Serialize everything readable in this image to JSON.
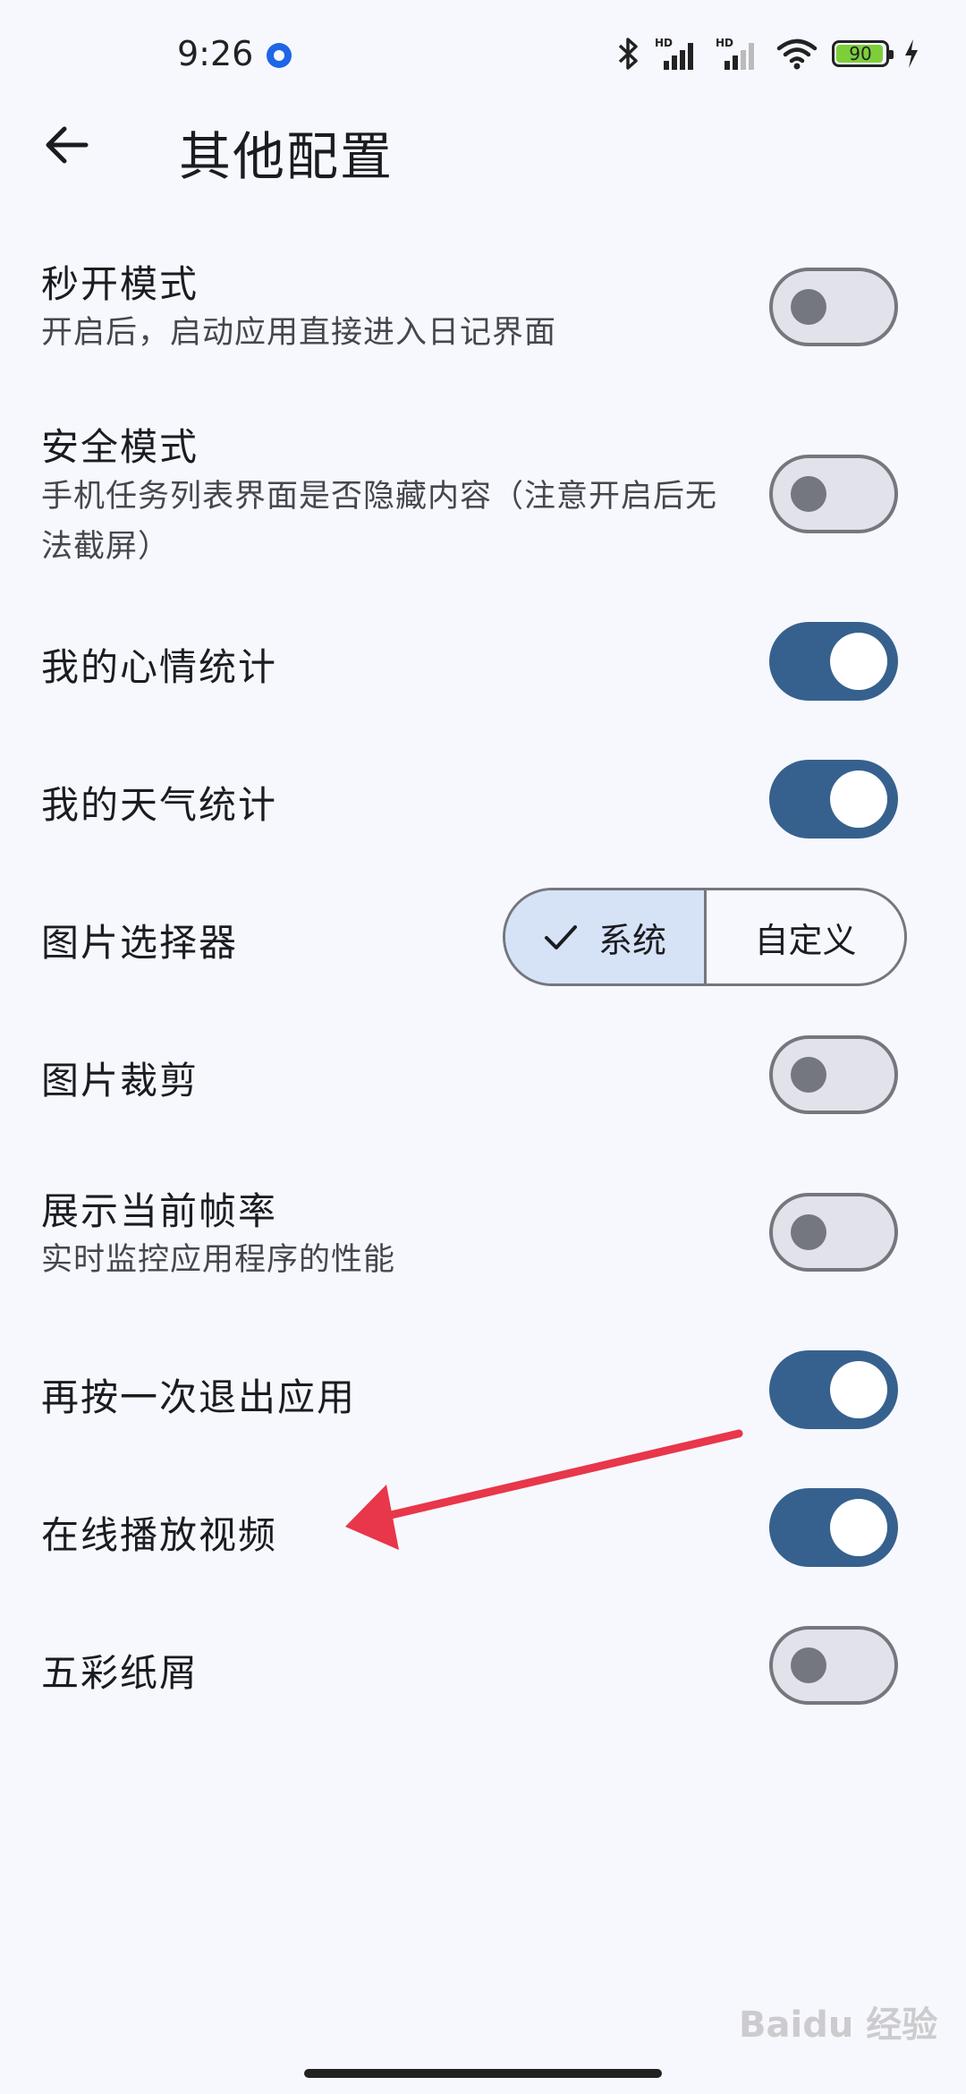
{
  "status_bar": {
    "time": "9:26",
    "battery_level": "90",
    "battery_percent": 90,
    "icons": [
      "app-notification-icon",
      "bluetooth-icon",
      "hd-signal-icon",
      "hd-signal-icon",
      "wifi-icon",
      "battery-icon",
      "charging-icon"
    ]
  },
  "header": {
    "title": "其他配置",
    "back_icon": "arrow-left-icon"
  },
  "settings": {
    "quick_open": {
      "title": "秒开模式",
      "subtitle": "开启后，启动应用直接进入日记界面",
      "enabled": false
    },
    "safe_mode": {
      "title": "安全模式",
      "subtitle": "手机任务列表界面是否隐藏内容（注意开启后无法截屏）",
      "enabled": false
    },
    "mood_stats": {
      "title": "我的心情统计",
      "enabled": true
    },
    "weather_stats": {
      "title": "我的天气统计",
      "enabled": true
    },
    "image_picker": {
      "title": "图片选择器",
      "options": [
        "系统",
        "自定义"
      ],
      "selected": "系统"
    },
    "image_crop": {
      "title": "图片裁剪",
      "enabled": false
    },
    "show_fps": {
      "title": "展示当前帧率",
      "subtitle": "实时监控应用程序的性能",
      "enabled": false
    },
    "double_back_exit": {
      "title": "再按一次退出应用",
      "enabled": true
    },
    "online_video": {
      "title": "在线播放视频",
      "enabled": true
    },
    "confetti": {
      "title": "五彩纸屑",
      "enabled": false
    }
  },
  "colors": {
    "background": "#f7f8fd",
    "switch_on": "#36618e",
    "switch_off_track": "#e2e3ea",
    "switch_off_outline": "#74777f",
    "segment_selected": "#d6e3f7",
    "annotation_arrow": "#e8364a"
  },
  "watermark": "Baidu 经验"
}
